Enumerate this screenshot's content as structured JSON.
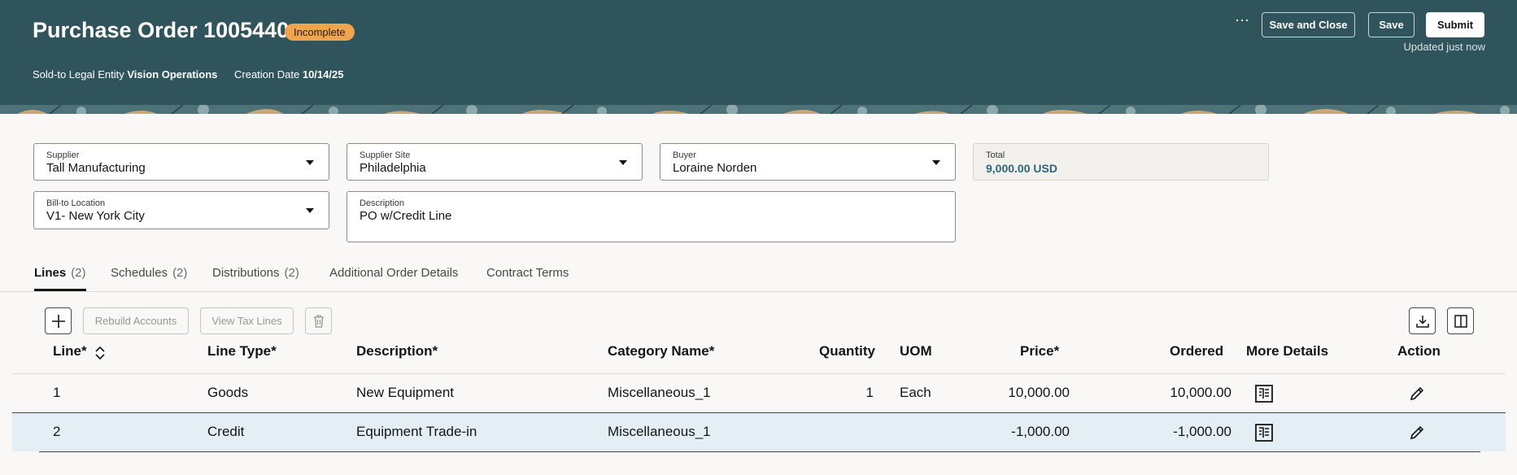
{
  "header": {
    "title": "Purchase Order 1005440",
    "status_badge": "Incomplete",
    "sold_to_label": "Sold-to Legal Entity",
    "sold_to_value": "Vision Operations",
    "creation_date_label": "Creation Date",
    "creation_date_value": "10/14/25",
    "more_actions_glyph": "⋯",
    "save_and_close_label": "Save and Close",
    "save_label": "Save",
    "submit_label": "Submit",
    "updated_text": "Updated just now"
  },
  "form": {
    "supplier": {
      "label": "Supplier",
      "value": "Tall Manufacturing"
    },
    "supplier_site": {
      "label": "Supplier Site",
      "value": "Philadelphia"
    },
    "buyer": {
      "label": "Buyer",
      "value": "Loraine Norden"
    },
    "total": {
      "label": "Total",
      "value": "9,000.00 USD"
    },
    "bill_to": {
      "label": "Bill-to Location",
      "value": "V1- New York City"
    },
    "description": {
      "label": "Description",
      "value": "PO w/Credit Line"
    }
  },
  "tabs": [
    {
      "label": "Lines",
      "count": "(2)",
      "active": true
    },
    {
      "label": "Schedules",
      "count": "(2)"
    },
    {
      "label": "Distributions",
      "count": "(2)"
    },
    {
      "label": "Additional Order Details",
      "count": ""
    },
    {
      "label": "Contract Terms",
      "count": ""
    }
  ],
  "toolbar": {
    "add_icon": "plus-icon",
    "rebuild_accounts_label": "Rebuild Accounts",
    "view_tax_lines_label": "View Tax Lines",
    "delete_icon": "trash-icon",
    "export_icon": "download-icon",
    "columns_icon": "columns-icon"
  },
  "table": {
    "columns": {
      "line": "Line*",
      "line_type": "Line Type*",
      "description": "Description*",
      "category": "Category Name*",
      "quantity": "Quantity",
      "uom": "UOM",
      "price": "Price*",
      "ordered": "Ordered",
      "more_details": "More Details",
      "action": "Action"
    },
    "rows": [
      {
        "line": "1",
        "line_type": "Goods",
        "description": "New Equipment",
        "category": "Miscellaneous_1",
        "quantity": "1",
        "uom": "Each",
        "price": "10,000.00",
        "ordered": "10,000.00"
      },
      {
        "line": "2",
        "line_type": "Credit",
        "description": "Equipment Trade-in",
        "category": "Miscellaneous_1",
        "quantity": "",
        "uom": "",
        "price": "-1,000.00",
        "ordered": "-1,000.00"
      }
    ]
  },
  "colors": {
    "header_bg": "#30545c",
    "badge_bg": "#f0a44e",
    "total_text": "#2b6777",
    "selected_row_bg": "#e4eff5"
  }
}
